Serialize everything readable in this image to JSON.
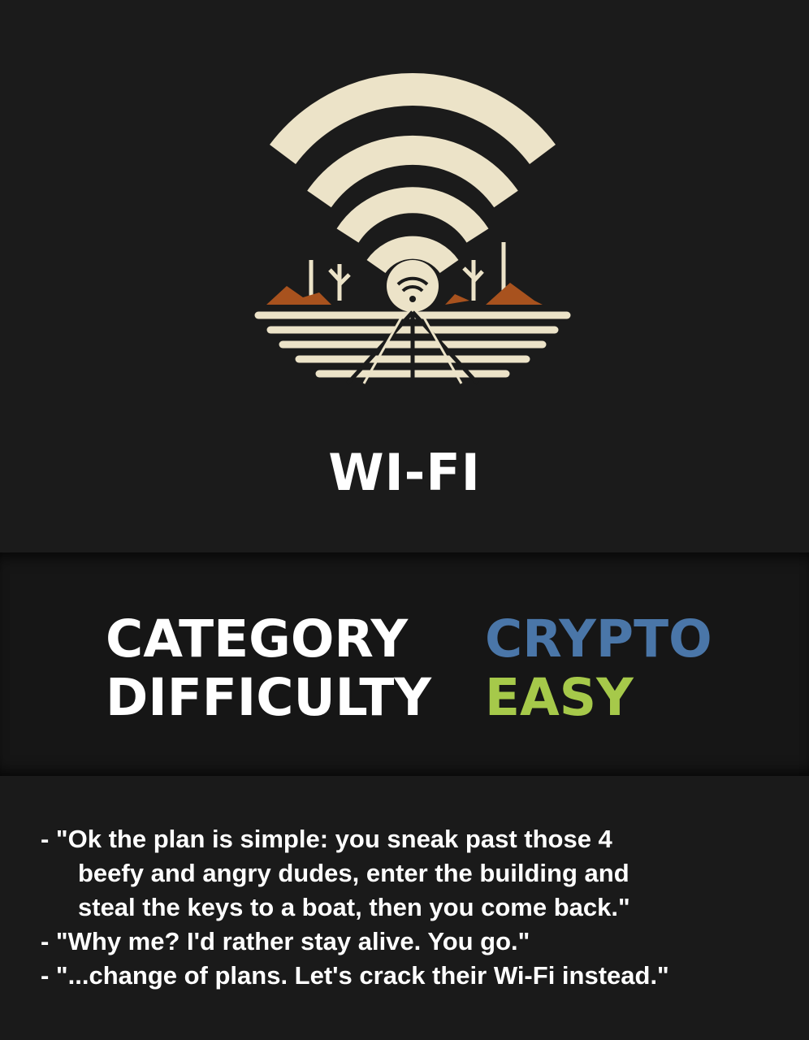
{
  "title": "WI-FI",
  "category_label": "CATEGORY",
  "category_value": "CRYPTO",
  "difficulty_label": "DIFFICULTY",
  "difficulty_value": "EASY",
  "colors": {
    "background": "#1b1b1b",
    "band": "#161616",
    "crypto": "#4a76a8",
    "easy": "#a6c94a",
    "logo_cream": "#ece3c8",
    "logo_rust": "#a8521e"
  },
  "logo": {
    "icon": "wifi-desert-logo"
  },
  "dialogue": [
    "- \"Ok the plan is simple: you sneak past those 4",
    "beefy and angry dudes, enter the building and",
    "steal the keys to a boat, then you come back.\"",
    "- \"Why me? I'd rather stay alive. You go.\"",
    "- \"...change of plans. Let's crack their Wi-Fi instead.\""
  ]
}
